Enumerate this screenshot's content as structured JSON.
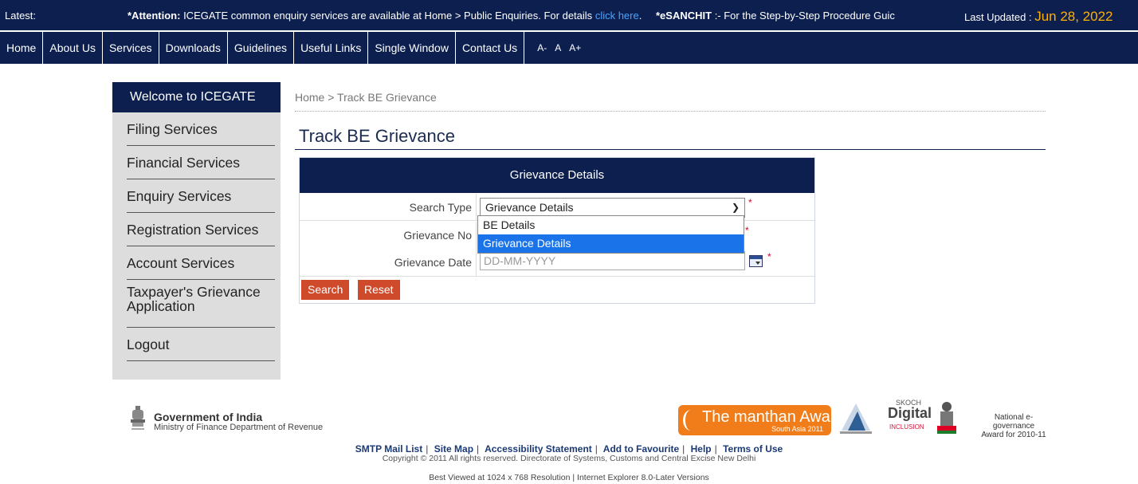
{
  "ticker": {
    "latest_label": "Latest:",
    "attention_strong": "*Attention:",
    "attention_text": "ICEGATE common enquiry services are available at Home > Public Enquiries. For details",
    "click_here": "click here",
    "dot": ".",
    "esanchit_strong": "*eSANCHIT",
    "esanchit_text": ":- For the Step-by-Step Procedure Guic",
    "last_updated_label": "Last Updated :",
    "last_updated_date": "Jun 28, 2022"
  },
  "nav": {
    "items": [
      "Home",
      "About Us",
      "Services",
      "Downloads",
      "Guidelines",
      "Useful Links",
      "Single Window",
      "Contact Us"
    ],
    "font_controls": [
      "A-",
      "A",
      "A+"
    ]
  },
  "sidebar": {
    "header": "Welcome to ICEGATE",
    "items": [
      "Filing Services",
      "Financial Services",
      "Enquiry Services",
      "Registration Services",
      "Account Services",
      "Taxpayer's Grievance Application",
      "Logout"
    ]
  },
  "breadcrumb": "Home > Track BE Grievance",
  "page_title": "Track BE Grievance",
  "form": {
    "panel_title": "Grievance Details",
    "search_type_label": "Search Type",
    "search_type_value": "Grievance Details",
    "search_type_options": [
      "BE Details",
      "Grievance Details"
    ],
    "grievance_no_label": "Grievance No",
    "grievance_date_label": "Grievance Date",
    "grievance_date_placeholder": "DD-MM-YYYY",
    "required_mark": "*",
    "search_button": "Search",
    "reset_button": "Reset"
  },
  "footer": {
    "gov_title": "Government of India",
    "gov_subtitle": "Ministry of Finance Department of Revenue",
    "manthan_big": "The manthan Award",
    "manthan_small": "South Asia 2011",
    "skoch_top": "SKOCH",
    "skoch_main": "Digital",
    "skoch_sub": "INCLUSION",
    "negov_line1": "National e-governance",
    "negov_line2": "Award for 2010-11",
    "links": [
      "SMTP Mail List",
      "Site Map",
      "Accessibility Statement",
      "Add to Favourite",
      "Help",
      "Terms of Use"
    ],
    "copyright": "Copyright © 2011 All rights reserved. Directorate of Systems, Customs and Central Excise New Delhi",
    "best_viewed": "Best Viewed at 1024 x 768 Resolution | Internet Explorer 8.0-Later Versions"
  },
  "colors": {
    "navy": "#0c1f4e",
    "button_red": "#cf4a2a",
    "highlight_blue": "#1a73e8",
    "date_orange": "#ffb000"
  }
}
